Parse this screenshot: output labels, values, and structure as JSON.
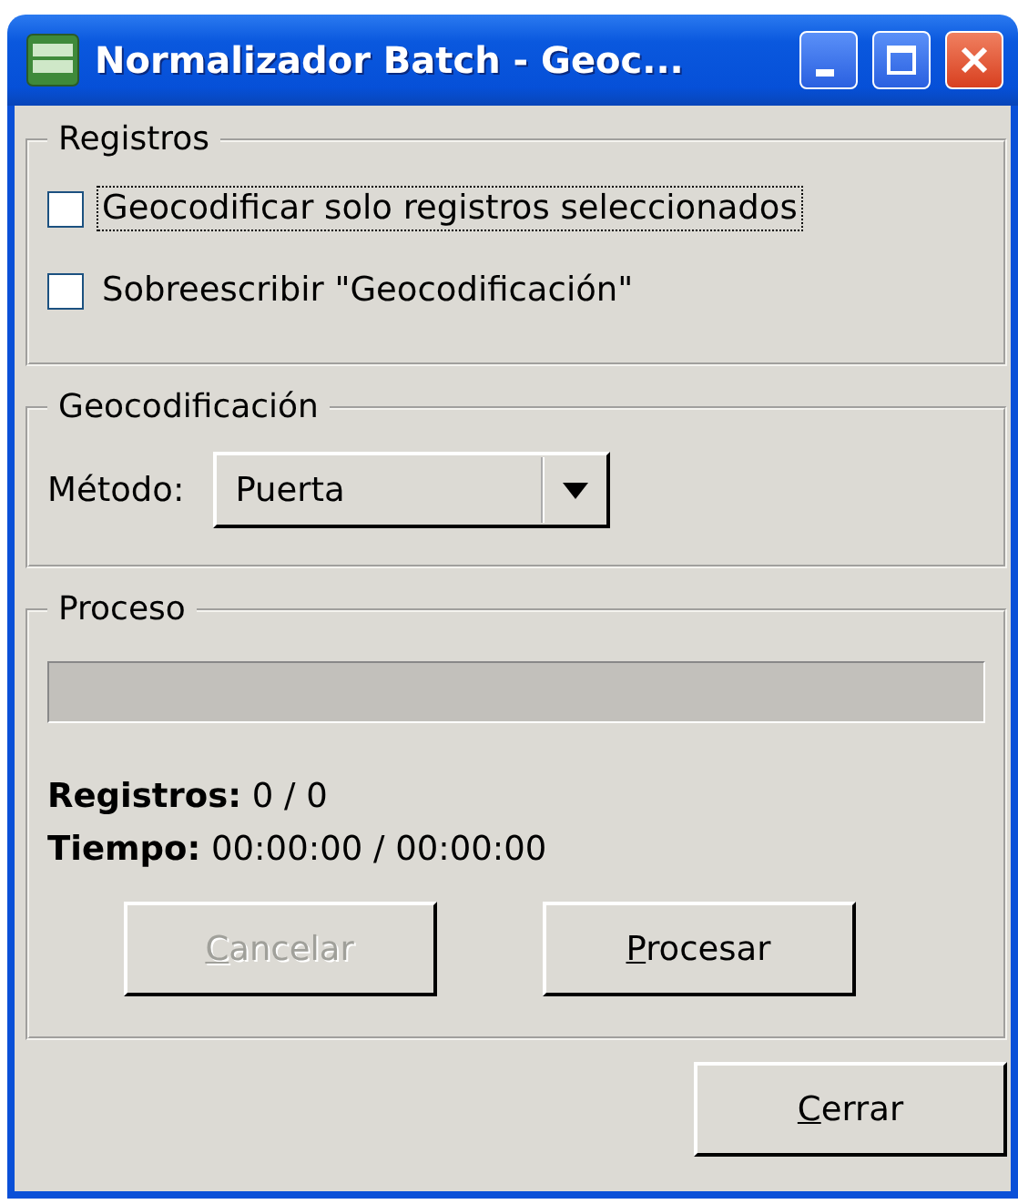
{
  "window": {
    "title": "Normalizador Batch - Geoc..."
  },
  "registros": {
    "legend": "Registros",
    "checkboxes": [
      {
        "label": "Geocodificar solo registros seleccionados",
        "checked": false,
        "focused": true
      },
      {
        "label": "Sobreescribir \"Geocodificación\"",
        "checked": false,
        "focused": false
      }
    ]
  },
  "geocodificacion": {
    "legend": "Geocodificación",
    "method_label": "Método:",
    "method_value": "Puerta"
  },
  "proceso": {
    "legend": "Proceso",
    "progress": {
      "level": 0
    },
    "lines": [
      "**Registros:** 0 / 0",
      "**Tiempo:** 00:00:00 / 00:00:00"
    ],
    "buttons": [
      {
        "label": "Cancelar",
        "disabled": true
      },
      {
        "label": "Procesar",
        "disabled": false
      }
    ]
  },
  "footer_buttons": [
    {
      "label": "Cerrar",
      "disabled": false
    }
  ]
}
